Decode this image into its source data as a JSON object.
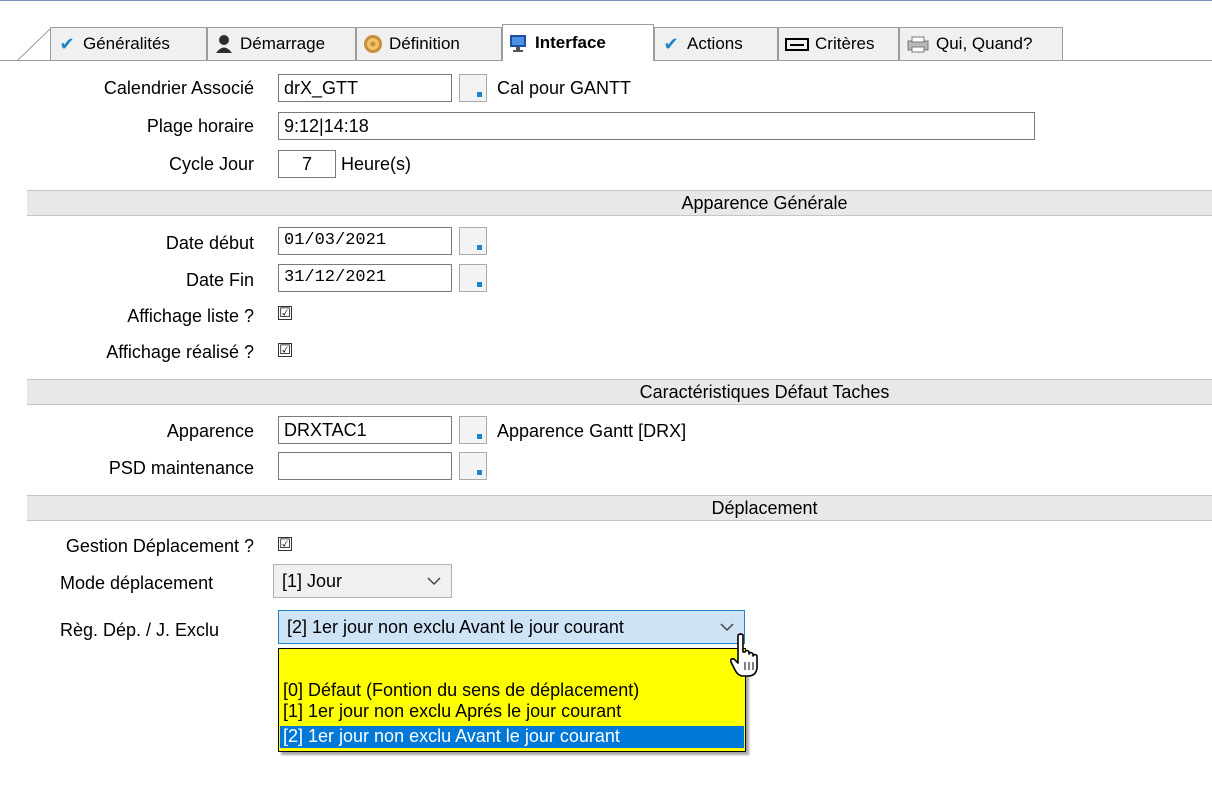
{
  "tabs": [
    {
      "label": "Généralités",
      "icon": "checkmark-icon"
    },
    {
      "label": "Démarrage",
      "icon": "user-icon"
    },
    {
      "label": "Définition",
      "icon": "gear-icon"
    },
    {
      "label": "Interface",
      "icon": "monitor-icon",
      "active": true
    },
    {
      "label": "Actions",
      "icon": "checkmark-icon"
    },
    {
      "label": "Critères",
      "icon": "keyboard-icon"
    },
    {
      "label": "Qui, Quand?",
      "icon": "printer-icon"
    }
  ],
  "form": {
    "calendrier": {
      "label": "Calendrier Associé",
      "value": "drX_GTT",
      "description": "Cal pour GANTT"
    },
    "plage": {
      "label": "Plage horaire",
      "value": "9:12|14:18"
    },
    "cycle": {
      "label": "Cycle Jour",
      "value": "7",
      "unit": "Heure(s)"
    }
  },
  "sections": {
    "apparence_generale": "Apparence Générale",
    "caracteristiques": "Caractéristiques Défaut Taches",
    "deplacement": "Déplacement"
  },
  "apparence": {
    "date_debut": {
      "label": "Date début",
      "value": "01/03/2021"
    },
    "date_fin": {
      "label": "Date Fin",
      "value": "31/12/2021"
    },
    "affichage_liste": {
      "label": "Affichage liste ?",
      "checked": true
    },
    "affichage_realise": {
      "label": "Affichage réalisé ?",
      "checked": true
    }
  },
  "taches": {
    "apparence": {
      "label": "Apparence",
      "value": "DRXTAC1",
      "description": "Apparence Gantt [DRX]"
    },
    "psd": {
      "label": "PSD maintenance",
      "value": ""
    }
  },
  "deplacement": {
    "gestion": {
      "label": "Gestion Déplacement ?",
      "checked": true
    },
    "mode": {
      "label": "Mode déplacement",
      "value": "[1] Jour"
    },
    "regle": {
      "label": "Règ. Dép. / J. Exclu",
      "value": "[2] 1er jour non exclu Avant le jour courant"
    },
    "options": [
      "[0] Défaut (Fontion du sens de déplacement)",
      "[1] 1er jour non  exclu Aprés le jour courant",
      "[2] 1er jour non exclu Avant le jour courant"
    ],
    "selected_index": 2,
    "check_mark": "☑"
  },
  "colors": {
    "accent": "#1c86c8",
    "dropdown_bg": "#ffff00",
    "selection": "#0078d7",
    "section_bg": "#e8e8e8"
  }
}
